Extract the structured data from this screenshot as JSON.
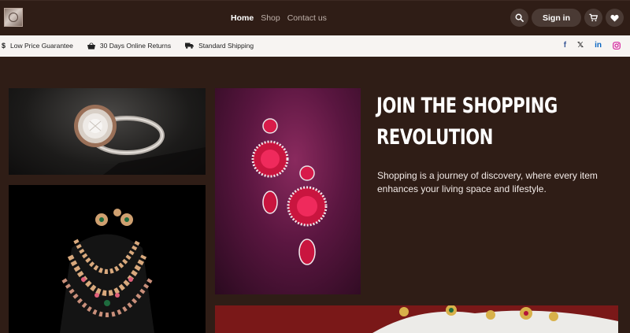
{
  "header": {
    "nav": [
      {
        "label": "Home",
        "active": true
      },
      {
        "label": "Shop",
        "active": false
      },
      {
        "label": "Contact us",
        "active": false
      }
    ],
    "signin_label": "Sign in",
    "icons": [
      "search-icon",
      "cart-icon",
      "heart-icon"
    ]
  },
  "infobar": {
    "items": [
      {
        "icon": "dollar-icon",
        "label": "Low Price Guarantee"
      },
      {
        "icon": "basket-icon",
        "label": "30 Days Online Returns"
      },
      {
        "icon": "truck-icon",
        "label": "Standard Shipping"
      }
    ],
    "socials": [
      {
        "icon": "facebook-icon",
        "color": "#3b5998"
      },
      {
        "icon": "x-icon",
        "color": "#111111"
      },
      {
        "icon": "linkedin-icon",
        "color": "#0a66c2"
      },
      {
        "icon": "instagram-icon",
        "color": "#d6249f"
      }
    ]
  },
  "hero": {
    "title_line1": "JOIN THE SHOPPING",
    "title_line2": "REVOLUTION",
    "body": "Shopping is a journey of discovery, where every item enhances your living space and lifestyle."
  },
  "colors": {
    "background": "#2f1d16",
    "infobar_bg": "#f7f4f2",
    "button_bg": "#4a3a34"
  }
}
